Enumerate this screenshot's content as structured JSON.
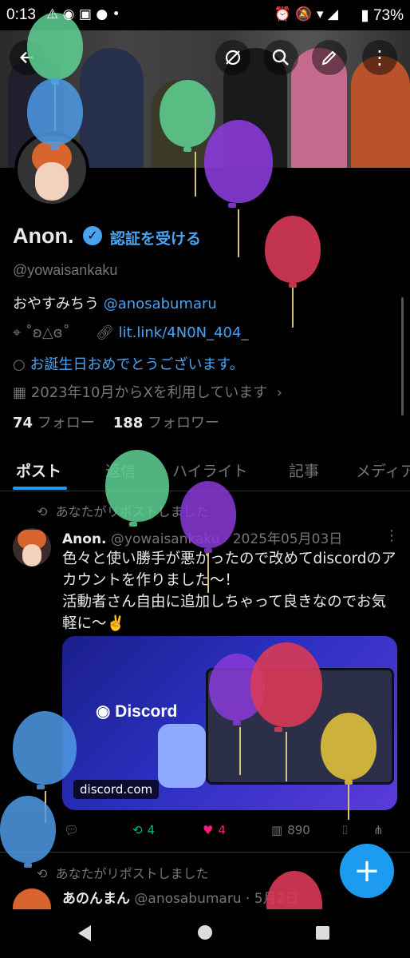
{
  "status_bar": {
    "time": "0:13",
    "battery": "73%"
  },
  "profile": {
    "name": "Anon.",
    "verify_label": "認証を受ける",
    "handle": "@yowaisankaku",
    "bio_text": "おやすみちう",
    "bio_mention": "@anosabumaru",
    "location": "˚ʚ△ɞ˚",
    "website": "lit.link/4N0N_404_",
    "birthday": "お誕生日おめでとうございます。",
    "joined": "2023年10月からXを利用しています",
    "following_count": "74",
    "following_label": "フォロー",
    "followers_count": "188",
    "followers_label": "フォロワー"
  },
  "tabs": [
    "ポスト",
    "返信",
    "ハイライト",
    "記事",
    "メディア"
  ],
  "post1": {
    "repost_note": "あなたがリポストしました",
    "author": "Anon.",
    "handle_date": "@yowaisankaku · 2025年05月03日",
    "text": "色々と使い勝手が悪かったので改めてdiscordのアカウントを作りました〜！\n活動者さん自由に追加しちゃって良きなのでお気軽に〜✌️",
    "media_brand": "Discord",
    "media_domain": "discord.com",
    "retweets": "4",
    "likes": "4",
    "views": "890"
  },
  "post2": {
    "repost_note": "あなたがリポストしました",
    "author": "あのんまん",
    "handle_date": "@anosabumaru · 5月2日"
  },
  "colors": {
    "accent": "#1d9bf0",
    "link": "#4aa3f0",
    "like": "#f91880",
    "retweet": "#00ba7c"
  }
}
